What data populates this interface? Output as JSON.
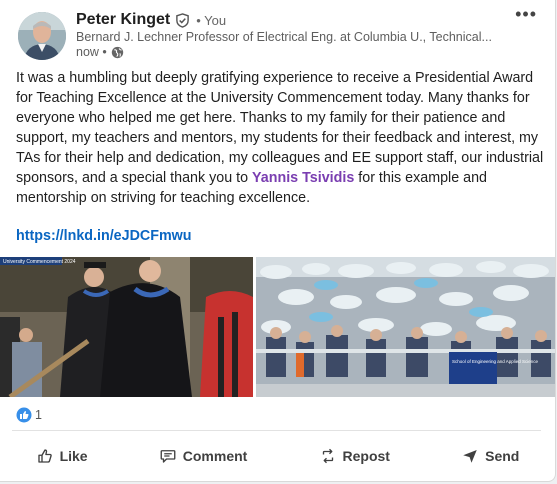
{
  "author": {
    "name": "Peter Kinget",
    "you_label": "• You",
    "headline": "Bernard J. Lechner Professor of Electrical Eng. at Columbia U., Technical...",
    "time": "now •"
  },
  "post": {
    "text_before_mention": "It was a humbling but deeply gratifying experience to receive a Presidential Award for Teaching Excellence at the University Commencement today. Many thanks for everyone who helped me get here. Thanks to my family for their patience and support, my teachers and mentors, my students for their feedback and interest, my TAs for their help and dedication, my colleagues and EE support staff, our industrial sponsors, and a special thank you to ",
    "mention": "Yannis Tsividis",
    "text_after_mention": " for this example and mentorship on striving for teaching excellence.",
    "link": "https://lnkd.in/eJDCFmwu"
  },
  "photos": {
    "photo1_caption": "University Commencement 2024",
    "photo2_sign": "School of Engineering and Applied Science"
  },
  "reactions": {
    "count": "1"
  },
  "actions": {
    "like": "Like",
    "comment": "Comment",
    "repost": "Repost",
    "send": "Send"
  },
  "colors": {
    "link": "#0a66c2",
    "mention": "#7a3eb1",
    "like_blue": "#378fe9"
  },
  "icons": [
    "verified-icon",
    "globe-icon",
    "more-icon",
    "like-icon",
    "comment-icon",
    "repost-icon",
    "send-icon"
  ]
}
